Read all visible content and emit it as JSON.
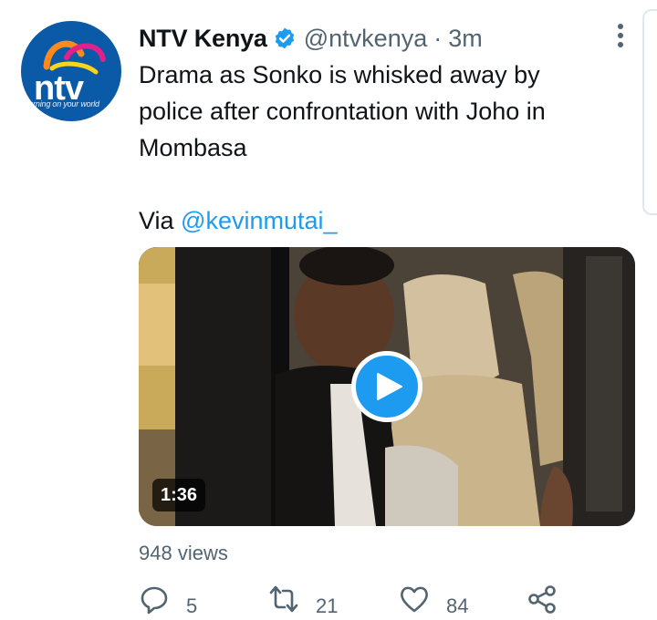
{
  "tweet": {
    "author": {
      "name": "NTV Kenya",
      "handle": "@ntvkenya",
      "verified_icon": "verified-badge-icon",
      "avatar": {
        "logo_text": "ntv",
        "tagline": "turning on your world"
      }
    },
    "separator": "·",
    "time": "3m",
    "text": "Drama as Sonko is whisked away by\npolice after confrontation with Joho in\nMombasa",
    "via_prefix": "Via ",
    "via_mention": "@kevinmutai_",
    "media": {
      "type": "video",
      "duration": "1:36",
      "play_icon": "play-icon"
    },
    "views": "948 views",
    "actions": {
      "reply": {
        "icon": "reply-icon",
        "count": "5"
      },
      "retweet": {
        "icon": "retweet-icon",
        "count": "21"
      },
      "like": {
        "icon": "heart-icon",
        "count": "84"
      },
      "share": {
        "icon": "share-icon"
      }
    },
    "colors": {
      "accent": "#1d9bf0",
      "text": "#0f1419",
      "muted": "#536471",
      "ntv_blue": "#0a5aa8"
    }
  }
}
